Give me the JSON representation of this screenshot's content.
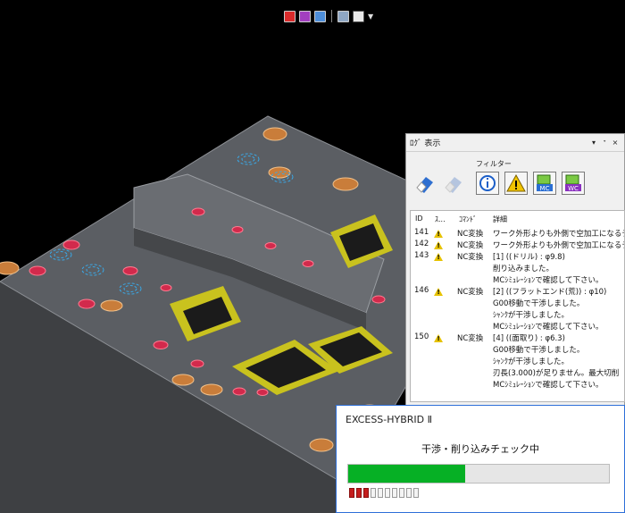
{
  "toolbar": {
    "icons": [
      "render-mode-icon",
      "material-icon",
      "view-icon",
      "print-icon",
      "display-menu-icon"
    ]
  },
  "log_panel": {
    "title": "ﾛｸﾞ 表示",
    "title_buttons": [
      "▾",
      "ᐩ",
      "×"
    ],
    "filter_label": "フィルター",
    "columns": [
      "ID",
      "ｽ...",
      "ｺﾏﾝﾄﾞ",
      "詳細"
    ],
    "rows": [
      {
        "id": "141",
        "status": "warning",
        "command": "NC変換",
        "detail": "ワーク外形よりも外側で空加工になるデ"
      },
      {
        "id": "142",
        "status": "warning",
        "command": "NC変換",
        "detail": "ワーク外形よりも外側で空加工になるデ"
      },
      {
        "id": "143",
        "status": "warning",
        "command": "NC変換",
        "detail": "[1] ((ドリル) : φ9.8)"
      },
      {
        "id": "",
        "status": "",
        "command": "",
        "detail": "削り込みました。"
      },
      {
        "id": "",
        "status": "",
        "command": "",
        "detail": "MCｼﾐｭﾚｰｼｮﾝで確認して下さい。"
      },
      {
        "id": "146",
        "status": "warning",
        "command": "NC変換",
        "detail": "[2] ((フラットエンド(荒)) : φ10)"
      },
      {
        "id": "",
        "status": "",
        "command": "",
        "detail": "G00移動で干渉しました。"
      },
      {
        "id": "",
        "status": "",
        "command": "",
        "detail": "ｼｬﾝｸが干渉しました。"
      },
      {
        "id": "",
        "status": "",
        "command": "",
        "detail": "MCｼﾐｭﾚｰｼｮﾝで確認して下さい。"
      },
      {
        "id": "150",
        "status": "warning",
        "command": "NC変換",
        "detail": "[4] ((面取り) : φ6.3)"
      },
      {
        "id": "",
        "status": "",
        "command": "",
        "detail": "G00移動で干渉しました。"
      },
      {
        "id": "",
        "status": "",
        "command": "",
        "detail": "ｼｬﾝｸが干渉しました。"
      },
      {
        "id": "",
        "status": "",
        "command": "",
        "detail": "刃長(3.000)が足りません。最大切削"
      },
      {
        "id": "",
        "status": "",
        "command": "",
        "detail": "MCｼﾐｭﾚｰｼｮﾝで確認して下さい。"
      }
    ]
  },
  "progress_dialog": {
    "title": "EXCESS-HYBRID Ⅱ",
    "message": "干渉・削り込みチェック中",
    "progress": 0.45,
    "steps_total": 10,
    "steps_done": 3
  },
  "colors": {
    "progress_fill": "#06b025",
    "step_on": "#c51d1d",
    "plate": "#5b5e63",
    "pocket_wall": "#c9c21e",
    "hole": "#d22a4c",
    "boss": "#c97d3a"
  }
}
